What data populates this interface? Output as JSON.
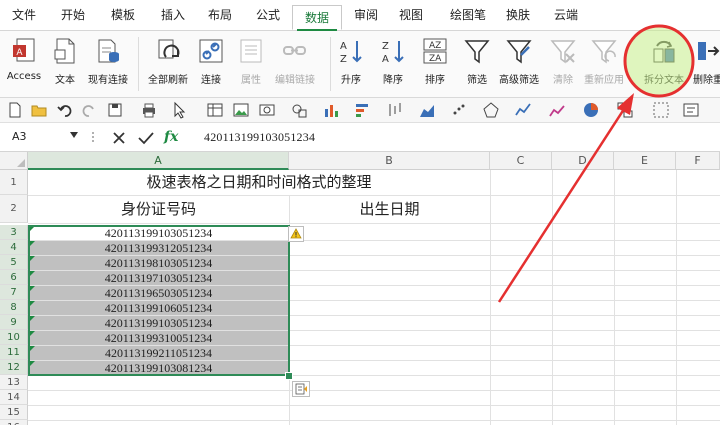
{
  "menu": {
    "tabs": [
      "文件",
      "开始",
      "模板",
      "插入",
      "布局",
      "公式",
      "数据",
      "审阅",
      "视图",
      "绘图笔",
      "换肤",
      "云端"
    ],
    "active_tab": "数据"
  },
  "ribbon": {
    "buttons": [
      {
        "label": "Access",
        "icon": "access-icon",
        "enabled": true
      },
      {
        "label": "文本",
        "icon": "text-file-icon",
        "enabled": true
      },
      {
        "label": "现有连接",
        "icon": "existing-connections-icon",
        "enabled": true
      },
      {
        "label": "全部刷新",
        "icon": "refresh-all-icon",
        "enabled": true
      },
      {
        "label": "连接",
        "icon": "connections-icon",
        "enabled": true
      },
      {
        "label": "属性",
        "icon": "properties-icon",
        "enabled": false
      },
      {
        "label": "编辑链接",
        "icon": "edit-links-icon",
        "enabled": false
      },
      {
        "label": "升序",
        "icon": "sort-ascending-icon",
        "enabled": true
      },
      {
        "label": "降序",
        "icon": "sort-descending-icon",
        "enabled": true
      },
      {
        "label": "排序",
        "icon": "sort-icon",
        "enabled": true
      },
      {
        "label": "筛选",
        "icon": "filter-icon",
        "enabled": true
      },
      {
        "label": "高级筛选",
        "icon": "advanced-filter-icon",
        "enabled": true
      },
      {
        "label": "清除",
        "icon": "clear-filter-icon",
        "enabled": false
      },
      {
        "label": "重新应用",
        "icon": "reapply-icon",
        "enabled": false
      },
      {
        "label": "拆分文本",
        "icon": "text-to-columns-icon",
        "enabled": true
      },
      {
        "label": "删除重",
        "icon": "remove-duplicates-icon",
        "enabled": true
      }
    ],
    "highlighted": "拆分文本"
  },
  "formula_bar": {
    "name_box": "A3",
    "fx": "fx",
    "formula": "420113199103051234"
  },
  "sheet": {
    "columns": [
      "A",
      "B",
      "C",
      "D",
      "E",
      "F"
    ],
    "rows": [
      "1",
      "2",
      "3",
      "4",
      "5",
      "6",
      "7",
      "8",
      "9",
      "10",
      "11",
      "12",
      "13",
      "14",
      "15",
      "16"
    ],
    "title": "极速表格之日期和时间格式的整理",
    "header_a": "身份证号码",
    "header_b": "出生日期",
    "ids": [
      "420113199103051234",
      "420113199312051234",
      "420113198103051234",
      "420113197103051234",
      "420113196503051234",
      "420113199106051234",
      "420113199103051234",
      "420113199310051234",
      "420113199211051234",
      "420113199103081234"
    ]
  },
  "colors": {
    "accent_green": "#1e8a42",
    "highlight_circle": "#e53030",
    "highlight_fill": "#c8f08c",
    "arrow": "#e53030",
    "selection_fill": "#c0c0c0"
  }
}
